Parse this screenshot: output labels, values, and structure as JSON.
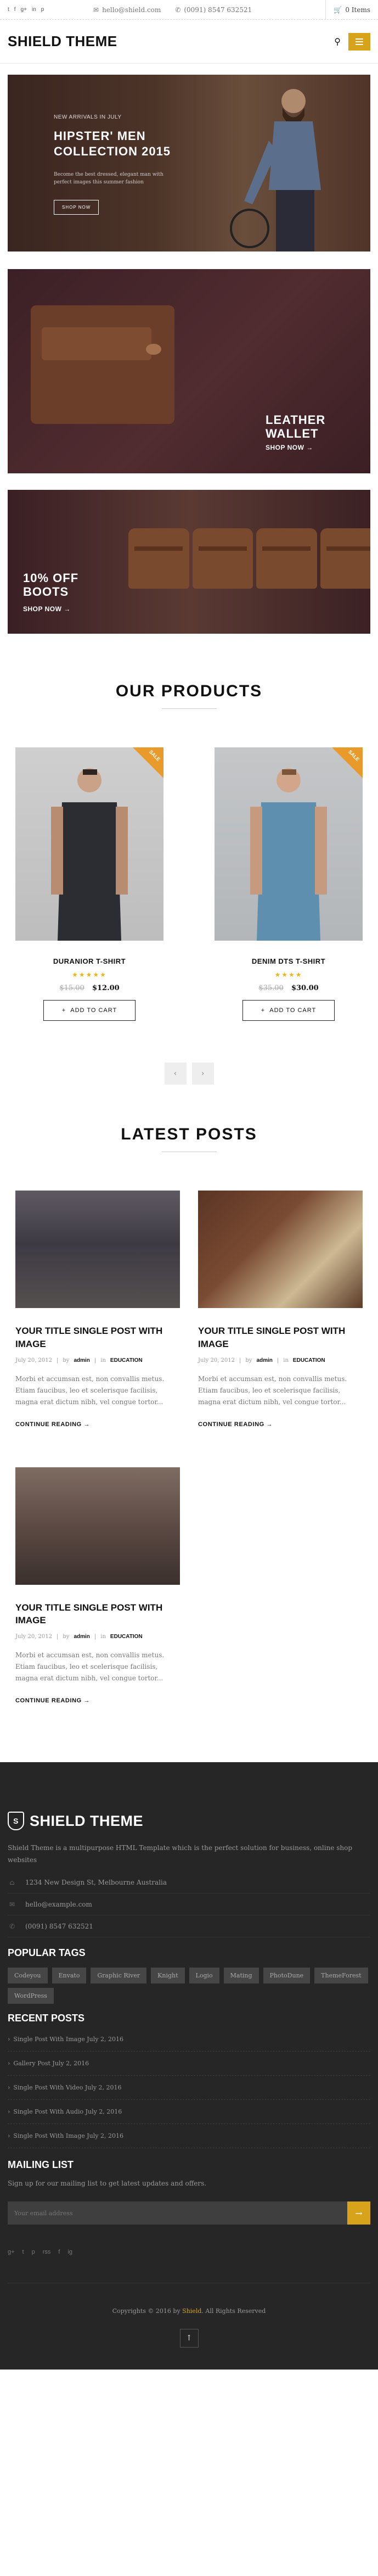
{
  "topbar": {
    "socials": [
      "t",
      "f",
      "g+",
      "in",
      "p"
    ],
    "email": "hello@shield.com",
    "phone": "(0091) 8547 632521",
    "cart_label": "0 Items"
  },
  "header": {
    "logo": "SHIELD THEME"
  },
  "banners": {
    "hero": {
      "kicker": "NEW ARRIVALS IN JULY",
      "title": "HIPSTER' MEN COLLECTION 2015",
      "desc": "Become the best dressed, elegant man with perfect images this summer fashion",
      "button": "SHOP NOW"
    },
    "wallet": {
      "title_line1": "LEATHER",
      "title_line2": "WALLET",
      "shop": "SHOP NOW →"
    },
    "boots": {
      "title_line1": "10% OFF",
      "title_line2": "BOOTS",
      "shop": "SHOP NOW →"
    }
  },
  "products_section": {
    "title": "OUR PRODUCTS",
    "items": [
      {
        "sale": "SALE",
        "name": "DURANIOR T-SHIRT",
        "stars": "★★★★★",
        "old_price": "$15.00",
        "price": "$12.00",
        "button": "ADD TO CART"
      },
      {
        "sale": "SALE",
        "name": "DENIM DTS T-SHIRT",
        "stars": "★★★★",
        "old_price": "$35.00",
        "price": "$30.00",
        "button": "ADD TO CART"
      }
    ],
    "prev": "‹",
    "next": "›"
  },
  "posts_section": {
    "title": "LATEST POSTS",
    "items": [
      {
        "title": "YOUR TITLE SINGLE POST WITH IMAGE",
        "date": "July 20, 2012",
        "by": "by",
        "author": "admin",
        "in": "in",
        "category": "EDUCATION",
        "excerpt": "Morbi et accumsan est, non convallis metus. Etiam faucibus, leo et scelerisque facilisis, magna erat dictum nibh, vel congue tortor...",
        "more": "CONTINUE READING →"
      },
      {
        "title": "YOUR TITLE SINGLE POST WITH IMAGE",
        "date": "July 20, 2012",
        "by": "by",
        "author": "admin",
        "in": "in",
        "category": "EDUCATION",
        "excerpt": "Morbi et accumsan est, non convallis metus. Etiam faucibus, leo et scelerisque facilisis, magna erat dictum nibh, vel congue tortor...",
        "more": "CONTINUE READING →"
      },
      {
        "title": "YOUR TITLE SINGLE POST WITH IMAGE",
        "date": "July 20, 2012",
        "by": "by",
        "author": "admin",
        "in": "in",
        "category": "EDUCATION",
        "excerpt": "Morbi et accumsan est, non convallis metus. Etiam faucibus, leo et scelerisque facilisis, magna erat dictum nibh, vel congue tortor...",
        "more": "CONTINUE READING →"
      }
    ]
  },
  "footer": {
    "logo": "SHIELD THEME",
    "shield_letter": "S",
    "about": "Shield Theme is a multipurpose HTML Template which is the perfect solution for business, online shop websites",
    "address": "1234 New Design St, Melbourne Australia",
    "email": "hello@example.com",
    "phone": "(0091) 8547 632521",
    "tags_heading": "POPULAR TAGS",
    "tags": [
      "Codeyou",
      "Envato",
      "Graphic River",
      "Knight",
      "Logio",
      "Mating",
      "PhotoDune",
      "ThemeForest",
      "WordPress"
    ],
    "recent_heading": "RECENT POSTS",
    "recent_posts": [
      "Single Post With Image July 2, 2016",
      "Gallery Post July 2, 2016",
      "Single Post With Video July 2, 2016",
      "Single Post With Audio July 2, 2016",
      "Single Post With Image July 2, 2016"
    ],
    "mailing_heading": "MAILING LIST",
    "mailing_text": "Sign up for our mailing list to get latest updates and offers.",
    "mailing_placeholder": "Your email address",
    "socials": [
      "g+",
      "t",
      "p",
      "rss",
      "f",
      "ig"
    ],
    "copyright_pre": "Copyrights © 2016 by",
    "copyright_brand": "Shield",
    "copyright_post": ". All Rights Reserved"
  },
  "colors": {
    "accent": "#d7a31a",
    "sale": "#e89a2b",
    "footer_bg": "#262626"
  }
}
